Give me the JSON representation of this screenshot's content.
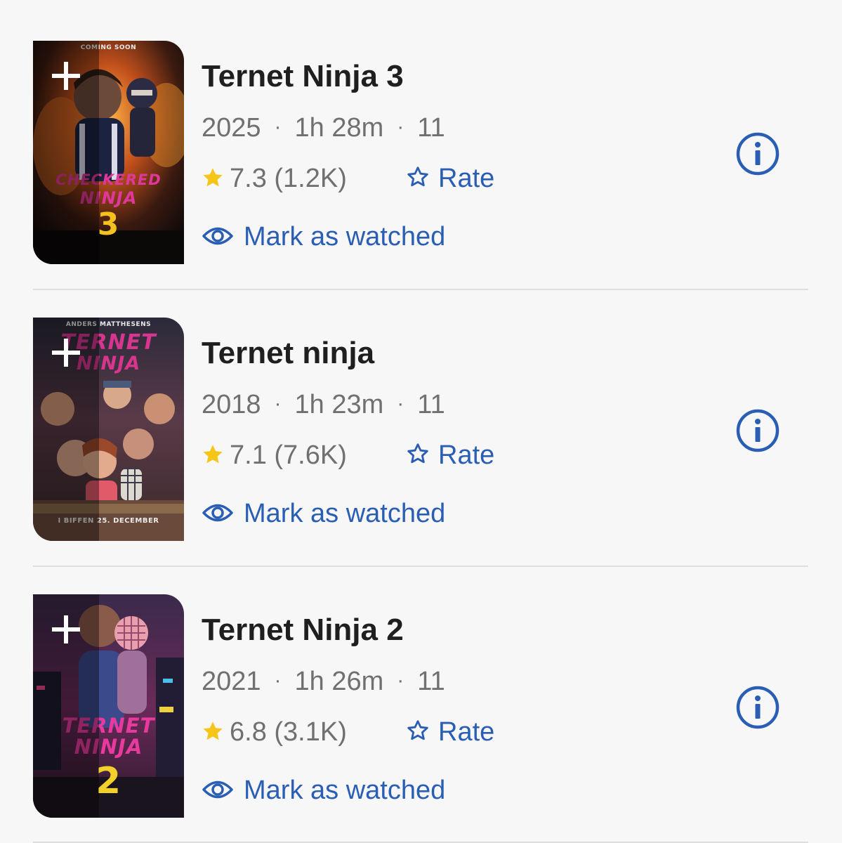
{
  "movies": [
    {
      "title": "Ternet Ninja 3",
      "year": "2025",
      "runtime": "1h 28m",
      "age_rating": "11",
      "rating": "7.3 (1.2K)",
      "rate_label": "Rate",
      "watched_label": "Mark as watched",
      "poster": {
        "top_text": "COMING SOON",
        "logo_line1": "CHECKERED",
        "logo_line2": "NINJA",
        "logo_line3": "3"
      }
    },
    {
      "title": "Ternet ninja",
      "year": "2018",
      "runtime": "1h 23m",
      "age_rating": "11",
      "rating": "7.1 (7.6K)",
      "rate_label": "Rate",
      "watched_label": "Mark as watched",
      "poster": {
        "top_text": "ANDERS MATTHESENS",
        "logo_line1": "TERNET",
        "logo_line2": "NINJA",
        "bottom_text": "I BIFFEN 25. DECEMBER"
      }
    },
    {
      "title": "Ternet Ninja 2",
      "year": "2021",
      "runtime": "1h 26m",
      "age_rating": "11",
      "rating": "6.8 (3.1K)",
      "rate_label": "Rate",
      "watched_label": "Mark as watched",
      "poster": {
        "logo_line1": "TERNET",
        "logo_line2": "NINJA",
        "logo_line3": "2"
      }
    }
  ],
  "separator": "·",
  "colors": {
    "accent": "#2a5eb4",
    "star": "#f5c518",
    "text_primary": "#1f1f1f",
    "text_secondary": "#707070",
    "background": "#f7f7f8",
    "divider": "#dedede"
  },
  "icons": {
    "add": "plus-icon",
    "star": "filled-star-icon",
    "rate": "outline-star-icon",
    "watched": "eye-icon",
    "info": "info-circle-icon"
  }
}
